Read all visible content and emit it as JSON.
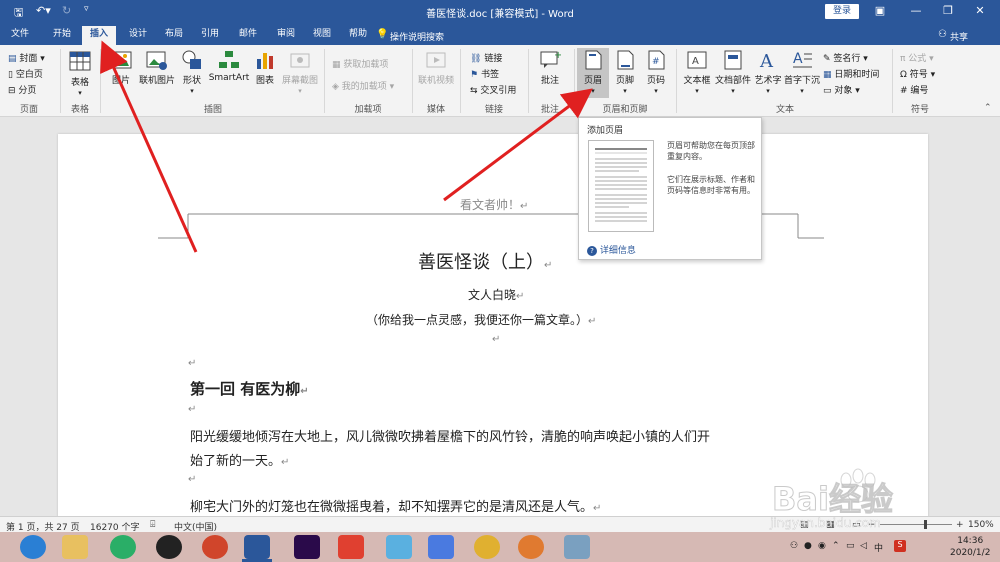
{
  "window": {
    "title": "善医怪谈.doc [兼容模式] - Word",
    "login_label": "登录"
  },
  "tabs": [
    "文件",
    "开始",
    "插入",
    "设计",
    "布局",
    "引用",
    "邮件",
    "审阅",
    "视图",
    "帮助"
  ],
  "active_tab": "插入",
  "tell_me": "操作说明搜索",
  "share": "共享",
  "ribbon": {
    "pages": {
      "cover": "封面",
      "blank": "空白页",
      "break": "分页",
      "label": "页面"
    },
    "tables": {
      "table": "表格",
      "label": "表格"
    },
    "illustrations": {
      "picture": "图片",
      "online_picture": "联机图片",
      "shapes": "形状",
      "smartart": "SmartArt",
      "chart": "图表",
      "screenshot": "屏幕截图",
      "label": "插图"
    },
    "addins": {
      "get": "获取加载项",
      "my": "我的加载项",
      "label": "加载项"
    },
    "media": {
      "online_video": "联机视频",
      "label": "媒体"
    },
    "links": {
      "link": "链接",
      "bookmark": "书签",
      "cross_ref": "交叉引用",
      "label": "链接"
    },
    "comments": {
      "comment": "批注",
      "label": "批注"
    },
    "header_footer": {
      "header": "页眉",
      "footer": "页脚",
      "page_number": "页码",
      "label": "页眉和页脚"
    },
    "text": {
      "textbox": "文本框",
      "quickparts": "文档部件",
      "wordart": "艺术字",
      "dropcap": "首字下沉",
      "signature": "签名行",
      "datetime": "日期和时间",
      "object": "对象",
      "label": "文本"
    },
    "symbols": {
      "equation": "公式",
      "symbol": "符号",
      "number": "编号",
      "label": "符号"
    }
  },
  "popup": {
    "title": "添加页眉",
    "desc1": "页眉可帮助您在每页顶部重复内容。",
    "desc2": "它们在展示标题、作者和页码等信息时非常有用。",
    "more": "详细信息"
  },
  "document": {
    "header_text": "看文者帅！",
    "title": "善医怪谈（上）",
    "author": "文人白晓",
    "subtitle": "（你给我一点灵感，我便还你一篇文章。）",
    "chapter": "第一回  有医为柳",
    "para1_line1": "阳光缓缓地倾泻在大地上，风儿微微吹拂着屋檐下的风竹铃，清脆的响声唤起小镇的人们开",
    "para1_line2": "始了新的一天。",
    "para2": "柳宅大门外的灯笼也在微微摇曳着，却不知摆弄它的是清风还是人气。",
    "para_mark": "↵"
  },
  "status": {
    "page": "第 1 页，共 27 页",
    "words": "16270 个字",
    "language": "中文(中国)",
    "zoom": "150%"
  },
  "clock": {
    "time": "14:36",
    "date": "2020/1/2"
  },
  "watermark": {
    "brand": "Bai经验",
    "url": "jingyan.baidu.com"
  },
  "colors": {
    "word_blue": "#2b579a",
    "arrow_red": "#e02020",
    "taskbar": "#d6b9b4"
  }
}
